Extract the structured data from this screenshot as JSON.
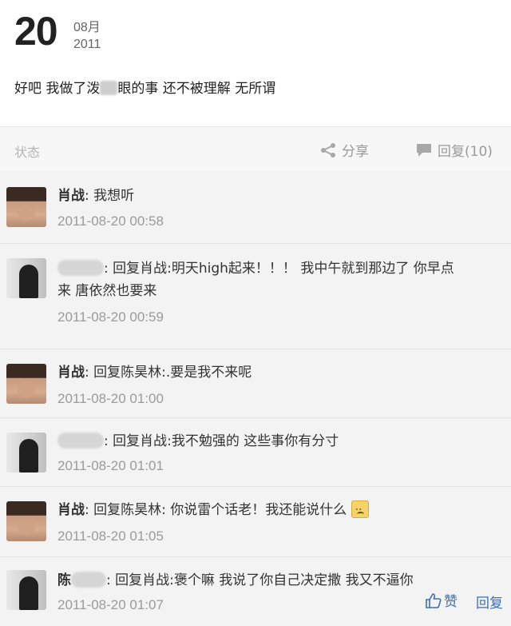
{
  "post": {
    "day": "20",
    "month": "08月",
    "year": "2011",
    "content_prefix": "好吧 我做了泼",
    "content_suffix": "眼的事 还不被理解 无所谓"
  },
  "actions": {
    "tag": "状态",
    "share_label": "分享",
    "reply_label": "回复(10)"
  },
  "comments": [
    {
      "author": "肖战",
      "text": ": 我想听",
      "time": "2011-08-20 00:58"
    },
    {
      "author": "",
      "text": ": 回复肖战:明天high起来！！！  我中午就到那边了 你早点",
      "text2": "来 唐依然也要来",
      "time": "2011-08-20 00:59"
    },
    {
      "author": "肖战",
      "text": ": 回复陈昊林:.要是我不来呢",
      "time": "2011-08-20 01:00"
    },
    {
      "author": "",
      "text": ": 回复肖战:我不勉强的 这些事你有分寸",
      "time": "2011-08-20 01:01"
    },
    {
      "author": "肖战",
      "text": ": 回复陈昊林: 你说雷个话老！我还能说什么",
      "time": "2011-08-20 01:05"
    },
    {
      "author": "陈",
      "text": ": 回复肖战:褒个嘛 我说了你自己决定撒 我又不逼你",
      "time": "2011-08-20 01:07"
    }
  ],
  "footer": {
    "like_label": "赞",
    "reply_label": "回复"
  },
  "icons": {
    "share": "share-icon",
    "reply": "comment-icon",
    "like": "thumbs-up-icon",
    "emoji": "sad-face-icon"
  },
  "colors": {
    "link": "#3a6fb5",
    "muted": "#9b9b9b",
    "comment_bg": "#f3f3f3"
  }
}
